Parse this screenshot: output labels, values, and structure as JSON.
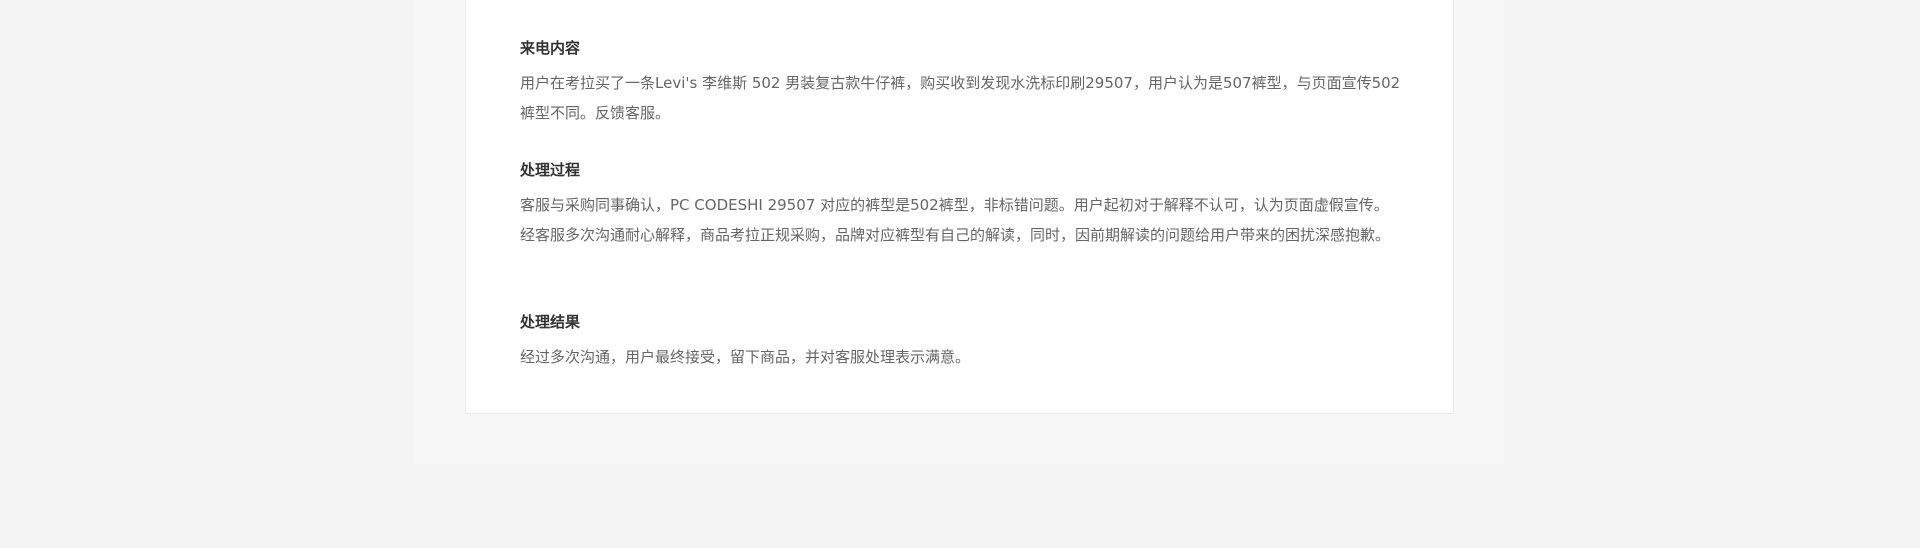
{
  "sections": [
    {
      "heading": "来电内容",
      "body": "用户在考拉买了一条Levi's 李维斯 502 男装复古款牛仔裤，购买收到发现水洗标印刷29507，用户认为是507裤型，与页面宣传502裤型不同。反馈客服。"
    },
    {
      "heading": "处理过程",
      "body": "客服与采购同事确认，PC CODESHI 29507 对应的裤型是502裤型，非标错问题。用户起初对于解释不认可，认为页面虚假宣传。经客服多次沟通耐心解释，商品考拉正规采购，品牌对应裤型有自己的解读，同时，因前期解读的问题给用户带来的困扰深感抱歉。"
    },
    {
      "heading": "处理结果",
      "body": "经过多次沟通，用户最终接受，留下商品，并对客服处理表示满意。"
    }
  ]
}
